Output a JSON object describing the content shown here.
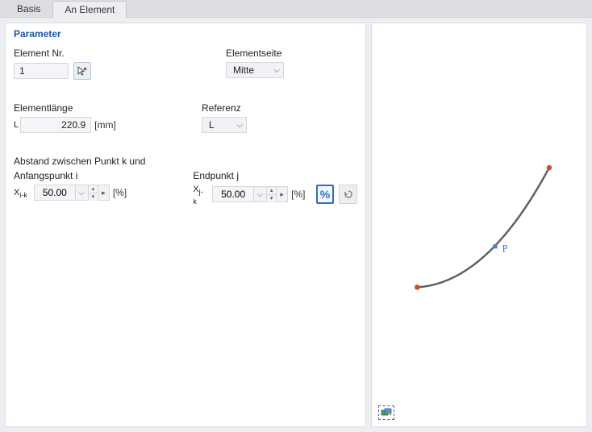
{
  "tabs": {
    "basis": "Basis",
    "an_element": "An Element"
  },
  "section_title": "Parameter",
  "element_nr_label": "Element Nr.",
  "element_nr_value": "1",
  "elementseite_label": "Elementseite",
  "elementseite_value": "Mitte",
  "length_label": "Elementlänge",
  "length_symbol": "L",
  "length_value": "220.9",
  "length_unit": "[mm]",
  "referenz_label": "Referenz",
  "referenz_value": "L",
  "distance_header": "Abstand zwischen Punkt k und",
  "anfang_label": "Anfangspunkt i",
  "end_label": "Endpunkt j",
  "xi_symbol": "X",
  "xi_sub": "i-k",
  "xj_symbol": "X",
  "xj_sub": "j-k",
  "xi_value": "50.00",
  "xj_value": "50.00",
  "pct_unit": "[%]",
  "pct_symbol": "%",
  "preview_label": "P"
}
